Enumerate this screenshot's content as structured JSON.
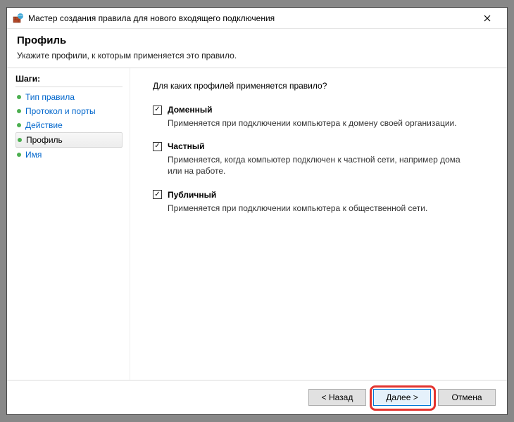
{
  "titlebar": {
    "icon": "firewall-wizard-icon",
    "title": "Мастер создания правила для нового входящего подключения"
  },
  "header": {
    "title": "Профиль",
    "subtitle": "Укажите профили, к которым применяется это правило."
  },
  "sidebar": {
    "title": "Шаги:",
    "steps": [
      {
        "label": "Тип правила",
        "current": false
      },
      {
        "label": "Протокол и порты",
        "current": false
      },
      {
        "label": "Действие",
        "current": false
      },
      {
        "label": "Профиль",
        "current": true
      },
      {
        "label": "Имя",
        "current": false
      }
    ]
  },
  "main": {
    "question": "Для каких профилей применяется правило?",
    "options": [
      {
        "checked": true,
        "label": "Доменный",
        "desc": "Применяется при подключении компьютера к домену своей организации."
      },
      {
        "checked": true,
        "label": "Частный",
        "desc": "Применяется, когда компьютер подключен к частной сети, например дома или на работе."
      },
      {
        "checked": true,
        "label": "Публичный",
        "desc": "Применяется при подключении компьютера к общественной сети."
      }
    ]
  },
  "footer": {
    "back": "< Назад",
    "next": "Далее >",
    "cancel": "Отмена"
  },
  "checkmark_glyph": "✓"
}
